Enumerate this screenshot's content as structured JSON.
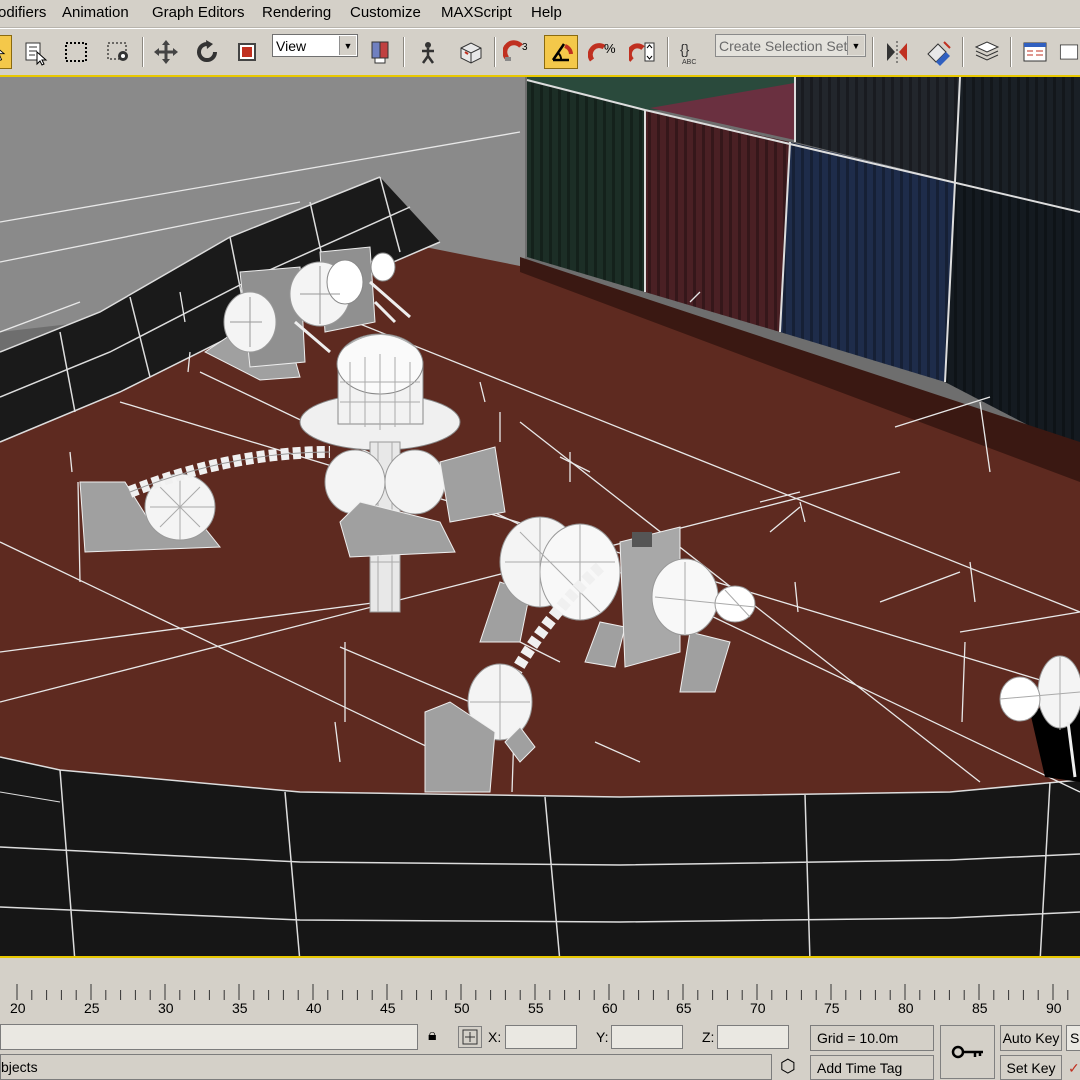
{
  "menu": [
    "odifiers",
    "Animation",
    "Graph Editors",
    "Rendering",
    "Customize",
    "MAXScript",
    "Help"
  ],
  "toolbar": {
    "view_dropdown": "View",
    "selection_set_placeholder": "Create Selection Set",
    "snap_count": "3",
    "percent_snap": "%"
  },
  "timeline": {
    "ticks": [
      "20",
      "25",
      "30",
      "35",
      "40",
      "45",
      "50",
      "55",
      "60",
      "65",
      "70",
      "75",
      "80",
      "85",
      "90"
    ]
  },
  "status": {
    "objects_label": "bjects",
    "x_label": "X:",
    "y_label": "Y:",
    "z_label": "Z:",
    "grid": "Grid = 10.0m",
    "add_time_tag": "Add Time Tag",
    "auto_key": "Auto Key",
    "set_key": "Set Key",
    "auto_key_side": "S"
  },
  "colors": {
    "active_button": "#f4c84a",
    "viewport_border": "#e8c800",
    "deck": "#5e2a20"
  }
}
